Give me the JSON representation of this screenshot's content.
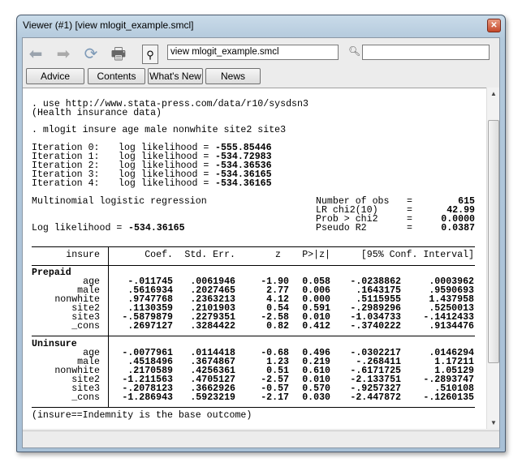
{
  "window": {
    "title": "Viewer (#1) [view mlogit_example.smcl]"
  },
  "toolbar": {
    "address": "view mlogit_example.smcl",
    "search": "",
    "icons": [
      "back-icon",
      "forward-icon",
      "refresh-icon",
      "print-icon",
      "find-icon",
      "search-icon"
    ]
  },
  "buttons": [
    "Advice",
    "Contents",
    "What's New",
    "News"
  ],
  "output": {
    "cmd1": ". use http://www.stata-press.com/data/r10/sysdsn3",
    "note1": "(Health insurance data)",
    "cmd2": ". mlogit insure age male nonwhite site2 site3",
    "iterations": [
      {
        "label": "Iteration 0:",
        "text": "log likelihood =",
        "value": "-555.85446"
      },
      {
        "label": "Iteration 1:",
        "text": "log likelihood =",
        "value": "-534.72983"
      },
      {
        "label": "Iteration 2:",
        "text": "log likelihood =",
        "value": "-534.36536"
      },
      {
        "label": "Iteration 3:",
        "text": "log likelihood =",
        "value": "-534.36165"
      },
      {
        "label": "Iteration 4:",
        "text": "log likelihood =",
        "value": "-534.36165"
      }
    ],
    "model": "Multinomial logistic regression",
    "loglik_label": "Log likelihood =",
    "loglik_value": "-534.36165",
    "stats": [
      {
        "label": "Number of obs",
        "eq": "=",
        "value": "615"
      },
      {
        "label": "LR chi2(10)",
        "eq": "=",
        "value": "42.99"
      },
      {
        "label": "Prob > chi2",
        "eq": "=",
        "value": "0.0000"
      },
      {
        "label": "Pseudo R2",
        "eq": "=",
        "value": "0.0387"
      }
    ],
    "table": {
      "headers": [
        "insure",
        "Coef.",
        "Std. Err.",
        "z",
        "P>|z|",
        "[95% Conf. Interval]"
      ],
      "groups": [
        {
          "name": "Prepaid",
          "rows": [
            [
              "age",
              "-.011745",
              ".0061946",
              "-1.90",
              "0.058",
              "-.0238862",
              ".0003962"
            ],
            [
              "male",
              ".5616934",
              ".2027465",
              "2.77",
              "0.006",
              ".1643175",
              ".9590693"
            ],
            [
              "nonwhite",
              ".9747768",
              ".2363213",
              "4.12",
              "0.000",
              ".5115955",
              "1.437958"
            ],
            [
              "site2",
              ".1130359",
              ".2101903",
              "0.54",
              "0.591",
              "-.2989296",
              ".5250013"
            ],
            [
              "site3",
              "-.5879879",
              ".2279351",
              "-2.58",
              "0.010",
              "-1.034733",
              "-.1412433"
            ],
            [
              "_cons",
              ".2697127",
              ".3284422",
              "0.82",
              "0.412",
              "-.3740222",
              ".9134476"
            ]
          ]
        },
        {
          "name": "Uninsure",
          "rows": [
            [
              "age",
              "-.0077961",
              ".0114418",
              "-0.68",
              "0.496",
              "-.0302217",
              ".0146294"
            ],
            [
              "male",
              ".4518496",
              ".3674867",
              "1.23",
              "0.219",
              "-.268411",
              "1.17211"
            ],
            [
              "nonwhite",
              ".2170589",
              ".4256361",
              "0.51",
              "0.610",
              "-.6171725",
              "1.05129"
            ],
            [
              "site2",
              "-1.211563",
              ".4705127",
              "-2.57",
              "0.010",
              "-2.133751",
              "-.2893747"
            ],
            [
              "site3",
              "-.2078123",
              ".3662926",
              "-0.57",
              "0.570",
              "-.9257327",
              ".510108"
            ],
            [
              "_cons",
              "-1.286943",
              ".5923219",
              "-2.17",
              "0.030",
              "-2.447872",
              "-.1260135"
            ]
          ]
        }
      ]
    },
    "footer": "(insure==Indemnity is the base outcome)"
  }
}
